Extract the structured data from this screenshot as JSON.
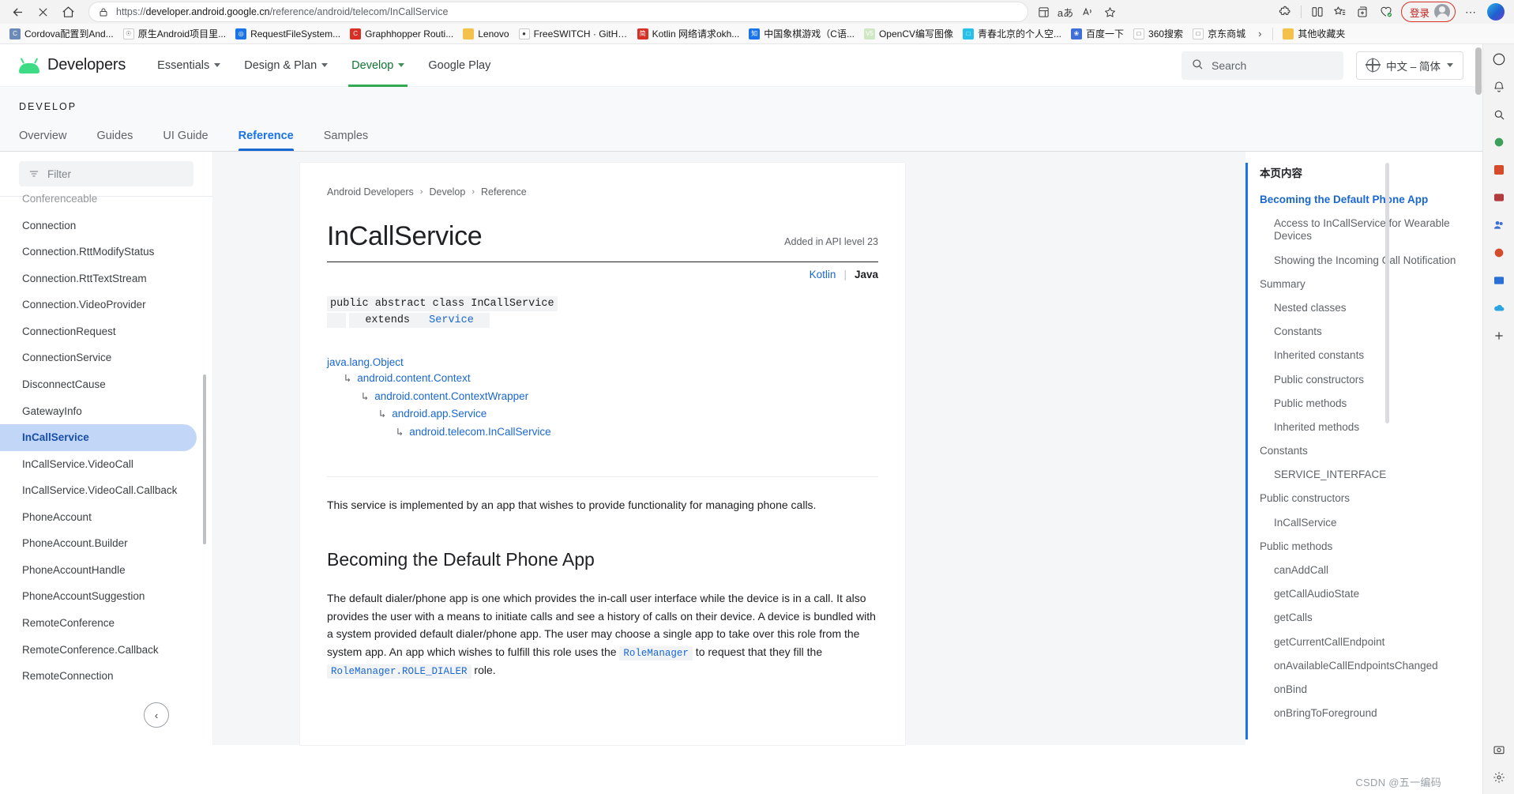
{
  "browser": {
    "back_label": "Back",
    "stop_label": "Stop",
    "home_label": "Home",
    "url_scheme": "https://",
    "url_host": "developer.android.google.cn",
    "url_path": "/reference/android/telecom/InCallService",
    "signin_label": "登录",
    "bookmarks": [
      {
        "title": "Cordova配置到And...",
        "color": "#6b8ab8",
        "glyph": "C"
      },
      {
        "title": "原生Android项目里...",
        "color": "#ffffff",
        "glyph": "☉"
      },
      {
        "title": "RequestFileSystem...",
        "color": "#1a73e8",
        "glyph": "◎"
      },
      {
        "title": "Graphhopper Routi...",
        "color": "#d93025",
        "glyph": "C"
      },
      {
        "title": "Lenovo",
        "color": "#f4c24b",
        "glyph": ""
      },
      {
        "title": "FreeSWITCH · GitHub",
        "color": "#ffffff",
        "glyph": "●"
      },
      {
        "title": "Kotlin 网络请求okh...",
        "color": "#d93025",
        "glyph": "简"
      },
      {
        "title": "中国象棋游戏（C语...",
        "color": "#1a73e8",
        "glyph": "知"
      },
      {
        "title": "OpenCV编写图像",
        "color": "#cfe8c4",
        "glyph": "V5"
      },
      {
        "title": "青春北京的个人空...",
        "color": "#27c0e8",
        "glyph": "□"
      },
      {
        "title": "百度一下",
        "color": "#3f6fd8",
        "glyph": "❀"
      },
      {
        "title": "360搜索",
        "color": "#ffffff",
        "glyph": "□"
      },
      {
        "title": "京东商城",
        "color": "#ffffff",
        "glyph": "□"
      }
    ],
    "overflow_label": "›",
    "other_bookmarks": "其他收藏夹"
  },
  "header": {
    "brand": "Developers",
    "nav": [
      {
        "label": "Essentials",
        "has_caret": true,
        "active": false
      },
      {
        "label": "Design & Plan",
        "has_caret": true,
        "active": false
      },
      {
        "label": "Develop",
        "has_caret": true,
        "active": true
      },
      {
        "label": "Google Play",
        "has_caret": false,
        "active": false
      }
    ],
    "search_placeholder": "Search",
    "language": "中文 – 简体"
  },
  "section": {
    "eyebrow": "DEVELOP",
    "tabs": [
      {
        "label": "Overview",
        "active": false
      },
      {
        "label": "Guides",
        "active": false
      },
      {
        "label": "UI Guide",
        "active": false
      },
      {
        "label": "Reference",
        "active": true
      },
      {
        "label": "Samples",
        "active": false
      }
    ]
  },
  "sidebar": {
    "filter_placeholder": "Filter",
    "items": [
      {
        "label": "Conferenceable",
        "active": false,
        "clipped": true
      },
      {
        "label": "Connection",
        "active": false
      },
      {
        "label": "Connection.RttModifyStatus",
        "active": false
      },
      {
        "label": "Connection.RttTextStream",
        "active": false
      },
      {
        "label": "Connection.VideoProvider",
        "active": false
      },
      {
        "label": "ConnectionRequest",
        "active": false
      },
      {
        "label": "ConnectionService",
        "active": false
      },
      {
        "label": "DisconnectCause",
        "active": false
      },
      {
        "label": "GatewayInfo",
        "active": false
      },
      {
        "label": "InCallService",
        "active": true
      },
      {
        "label": "InCallService.VideoCall",
        "active": false
      },
      {
        "label": "InCallService.VideoCall.Callback",
        "active": false
      },
      {
        "label": "PhoneAccount",
        "active": false
      },
      {
        "label": "PhoneAccount.Builder",
        "active": false
      },
      {
        "label": "PhoneAccountHandle",
        "active": false
      },
      {
        "label": "PhoneAccountSuggestion",
        "active": false
      },
      {
        "label": "RemoteConference",
        "active": false
      },
      {
        "label": "RemoteConference.Callback",
        "active": false
      },
      {
        "label": "RemoteConnection",
        "active": false
      }
    ],
    "collapse_label": "‹"
  },
  "article": {
    "breadcrumb": [
      "Android Developers",
      "Develop",
      "Reference"
    ],
    "breadcrumb_sep": "›",
    "title": "InCallService",
    "api_level": "Added in API level 23",
    "lang_kotlin": "Kotlin",
    "lang_bar": "|",
    "lang_java": "Java",
    "signature_line1": "public abstract class InCallService",
    "signature_extends_kw": "extends",
    "signature_extends_type": "Service",
    "inheritance": [
      {
        "indent": 0,
        "arrow": "",
        "label": "java.lang.Object"
      },
      {
        "indent": 1,
        "arrow": "↳",
        "label": "android.content.Context"
      },
      {
        "indent": 2,
        "arrow": "↳",
        "label": "android.content.ContextWrapper"
      },
      {
        "indent": 3,
        "arrow": "↳",
        "label": "android.app.Service"
      },
      {
        "indent": 4,
        "arrow": "↳",
        "label": "android.telecom.InCallService"
      }
    ],
    "intro": "This service is implemented by an app that wishes to provide functionality for managing phone calls.",
    "section_heading": "Becoming the Default Phone App",
    "body_part1": "The default dialer/phone app is one which provides the in-call user interface while the device is in a call. It also provides the user with a means to initiate calls and see a history of calls on their device. A device is bundled with a system provided default dialer/phone app. The user may choose a single app to take over this role from the system app. An app which wishes to fulfill this role uses the ",
    "body_code1": "RoleManager",
    "body_part2": " to request that they fill the ",
    "body_code2": "RoleManager.ROLE_DIALER",
    "body_part3": " role."
  },
  "toc": {
    "title": "本页内容",
    "items": [
      {
        "label": "Becoming the Default Phone App",
        "level": 1,
        "current": true
      },
      {
        "label": "Access to InCallService for Wearable Devices",
        "level": 2,
        "current": false
      },
      {
        "label": "Showing the Incoming Call Notification",
        "level": 2,
        "current": false
      },
      {
        "label": "Summary",
        "level": 1,
        "current": false
      },
      {
        "label": "Nested classes",
        "level": 2,
        "current": false
      },
      {
        "label": "Constants",
        "level": 2,
        "current": false
      },
      {
        "label": "Inherited constants",
        "level": 2,
        "current": false
      },
      {
        "label": "Public constructors",
        "level": 2,
        "current": false
      },
      {
        "label": "Public methods",
        "level": 2,
        "current": false
      },
      {
        "label": "Inherited methods",
        "level": 2,
        "current": false
      },
      {
        "label": "Constants",
        "level": 1,
        "current": false
      },
      {
        "label": "SERVICE_INTERFACE",
        "level": 2,
        "current": false
      },
      {
        "label": "Public constructors",
        "level": 1,
        "current": false
      },
      {
        "label": "InCallService",
        "level": 2,
        "current": false
      },
      {
        "label": "Public methods",
        "level": 1,
        "current": false
      },
      {
        "label": "canAddCall",
        "level": 2,
        "current": false
      },
      {
        "label": "getCallAudioState",
        "level": 2,
        "current": false
      },
      {
        "label": "getCalls",
        "level": 2,
        "current": false
      },
      {
        "label": "getCurrentCallEndpoint",
        "level": 2,
        "current": false
      },
      {
        "label": "onAvailableCallEndpointsChanged",
        "level": 2,
        "current": false
      },
      {
        "label": "onBind",
        "level": 2,
        "current": false
      },
      {
        "label": "onBringToForeground",
        "level": 2,
        "current": false
      }
    ]
  },
  "watermark": "CSDN @五一编码",
  "colors": {
    "accent_blue": "#1a73e8",
    "link_blue": "#1967d2",
    "android_green": "#3ddc84",
    "develop_green": "#34a853",
    "active_nav_bg": "#c2d7f8",
    "signin_red": "#d93025"
  }
}
